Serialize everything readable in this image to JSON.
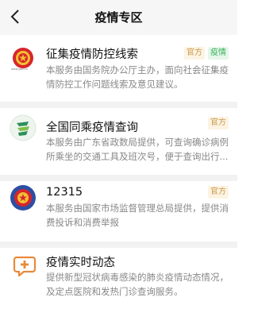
{
  "header": {
    "title": "疫情专区",
    "back_icon": "chevron-left-icon"
  },
  "items": [
    {
      "name": "征集疫情防控线索",
      "description": "本服务由国务院办公厅主办，面向社会征集疫情防控工作问题线索及意见建议。",
      "tags": [
        "官方",
        "疫情"
      ],
      "logo_caption": "www.gov.cn",
      "icon": "national-emblem-icon"
    },
    {
      "name": "全国同乘疫情查询",
      "description": "本服务由广东省政数局提供，可查询确诊病例所乘坐的交通工具及班次号，便于查询出行...",
      "tags": [
        "官方"
      ],
      "icon": "guangdong-logo-icon"
    },
    {
      "name": "12315",
      "description": "本服务由国家市场监督管理总局提供，提供消费投诉和消费举报",
      "tags": [
        "官方"
      ],
      "icon": "national-emblem-icon"
    },
    {
      "name": "疫情实时动态",
      "description": "提供新型冠状病毒感染的肺炎疫情动态情况，及定点医院和发热门诊查询服务。",
      "tags": [],
      "icon": "medical-chat-icon"
    }
  ],
  "colors": {
    "tag_official_bg": "#fdf3e3",
    "tag_official_text": "#c99a4a",
    "tag_epidemic_bg": "#e6f6ea",
    "tag_epidemic_text": "#3bb15e"
  }
}
